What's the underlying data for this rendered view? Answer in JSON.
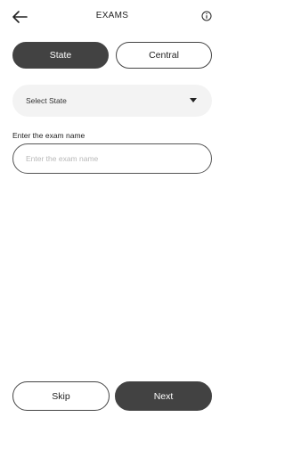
{
  "header": {
    "title": "EXAMS",
    "back_icon": "arrow-left-icon",
    "info_icon": "info-circle-icon"
  },
  "tabs": {
    "state_label": "State",
    "central_label": "Central",
    "selected": "State"
  },
  "state_select": {
    "value": "Select State",
    "caret_icon": "caret-down-icon"
  },
  "exam_name": {
    "label": "Enter the exam name",
    "placeholder": "Enter the exam name",
    "value": ""
  },
  "footer": {
    "skip_label": "Skip",
    "next_label": "Next"
  },
  "colors": {
    "dark": "#424242",
    "field_bg": "#f3f3f3",
    "placeholder": "#b8b8b8"
  }
}
